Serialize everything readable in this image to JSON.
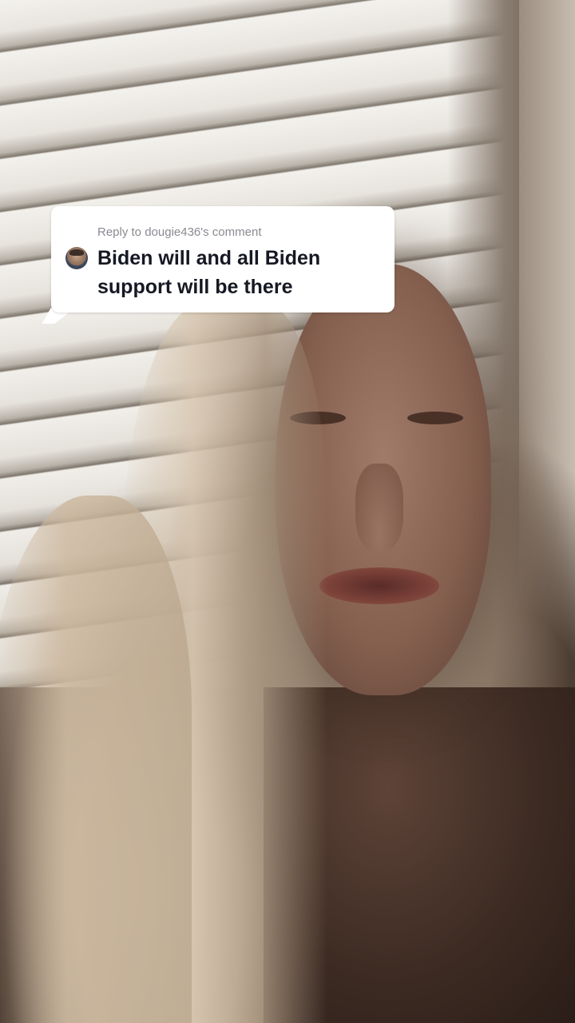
{
  "reply_card": {
    "header": "Reply to dougie436's comment",
    "comment_text": "Biden will and all Biden support will be there",
    "avatar_icon": "user-avatar-icon"
  },
  "colors": {
    "bubble_background": "#ffffff",
    "header_text": "#8a8b91",
    "comment_text": "#161823"
  }
}
